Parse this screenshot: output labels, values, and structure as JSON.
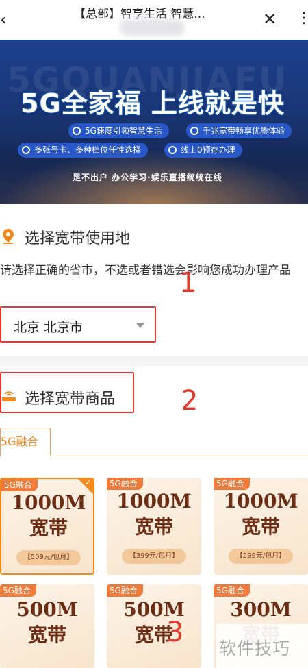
{
  "nav": {
    "title": "【总部】智享生活 智慧...",
    "back_icon": "‹",
    "close_icon": "✕",
    "more_icon": "⋮"
  },
  "banner": {
    "ghost_text": "5GQUANJIAFU",
    "headline": "5G全家福  上线就是快",
    "features": [
      "5G速度引领智慧生活",
      "千兆宽带畅享优质体验",
      "多张号卡、多种档位任性选择",
      "线上0预存办理"
    ],
    "slogan": "足不出户 办公学习·娱乐直播统统在线"
  },
  "section_location": {
    "title": "选择宽带使用地",
    "notice": "请选择正确的省市，不选或者错选会影响您成功办理产品",
    "region_value": "北京  北京市"
  },
  "section_products": {
    "title": "选择宽带商品",
    "tab_label": "5G融合",
    "cards": [
      {
        "tag": "5G融合",
        "speed": "1000M",
        "kind": "宽带",
        "price": "【509元/包月】",
        "selected": true
      },
      {
        "tag": "5G融合",
        "speed": "1000M",
        "kind": "宽带",
        "price": "【399元/包月】",
        "selected": false
      },
      {
        "tag": "5G融合",
        "speed": "1000M",
        "kind": "宽带",
        "price": "【299元/包月】",
        "selected": false
      },
      {
        "tag": "5G融合",
        "speed": "500M",
        "kind": "宽带"
      },
      {
        "tag": "5G融合",
        "speed": "500M",
        "kind": "宽带"
      },
      {
        "tag": "5G融合",
        "speed": "300M",
        "kind": "宽带"
      }
    ]
  },
  "annotations": [
    "1",
    "2",
    "3"
  ],
  "watermark": "软件技巧",
  "colors": {
    "accent": "#f08a1e",
    "annotation_red": "#e23a2f",
    "banner_blue": "#1c3f8e"
  }
}
